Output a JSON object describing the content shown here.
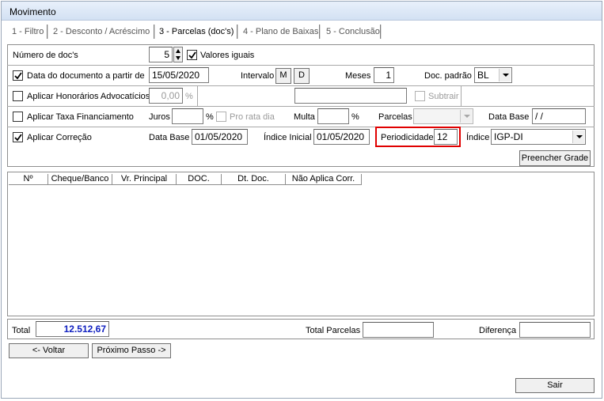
{
  "window": {
    "title": "Movimento"
  },
  "tabs": [
    {
      "label": "1 - Filtro",
      "active": false
    },
    {
      "label": "2 - Desconto / Acréscimo",
      "active": false
    },
    {
      "label": "3 - Parcelas (doc's)",
      "active": true
    },
    {
      "label": "4 - Plano de Baixas",
      "active": false
    },
    {
      "label": "5 - Conclusão",
      "active": false
    }
  ],
  "row1": {
    "num_docs_label": "Número de doc's",
    "num_docs_value": "5",
    "valores_iguais_label": "Valores iguais",
    "valores_iguais_checked": true
  },
  "row2": {
    "data_doc_label": "Data do documento a partir de",
    "data_doc_checked": true,
    "data_doc_value": "15/05/2020",
    "intervalo_label": "Intervalo",
    "intervalo_m": "M",
    "intervalo_d": "D",
    "meses_label": "Meses",
    "meses_value": "1",
    "doc_padrao_label": "Doc. padrão",
    "doc_padrao_value": "BL"
  },
  "row3": {
    "honorarios_label": "Aplicar Honorários Advocatícios",
    "honorarios_checked": false,
    "honorarios_value": "0,00",
    "percent": "%",
    "descricao_value": "",
    "subtrair_label": "Subtrair",
    "subtrair_checked": false
  },
  "row4": {
    "taxa_label": "Aplicar Taxa Financiamento",
    "taxa_checked": false,
    "juros_label": "Juros",
    "juros_value": "",
    "percent": "%",
    "pro_rata_label": "Pro rata dia",
    "pro_rata_checked": false,
    "multa_label": "Multa",
    "multa_value": "",
    "parcelas_label": "Parcelas",
    "parcelas_value": "",
    "data_base_label": "Data Base",
    "data_base_value": " / /"
  },
  "row5": {
    "correcao_label": "Aplicar Correção",
    "correcao_checked": true,
    "data_base_label": "Data Base",
    "data_base_value": "01/05/2020",
    "indice_inicial_label": "Índice Inicial",
    "indice_inicial_value": "01/05/2020",
    "periodicidade_label": "Periodicidade",
    "periodicidade_value": "12",
    "indice_label": "Índice",
    "indice_value": "IGP-DI"
  },
  "preencher_grade_label": "Preencher Grade",
  "grid": {
    "columns": [
      "Nº",
      "Cheque/Banco",
      "Vr. Principal",
      "DOC.",
      "Dt. Doc.",
      "Não Aplica Corr."
    ]
  },
  "footer": {
    "total_label": "Total",
    "total_value": "12.512,67",
    "total_parcelas_label": "Total Parcelas",
    "total_parcelas_value": "",
    "diferenca_label": "Diferença",
    "diferenca_value": ""
  },
  "nav": {
    "voltar_label": "<- Voltar",
    "proximo_label": "Próximo Passo ->",
    "sair_label": "Sair"
  },
  "colors": {
    "highlight": "#e00000",
    "total_value": "#1020c0"
  }
}
